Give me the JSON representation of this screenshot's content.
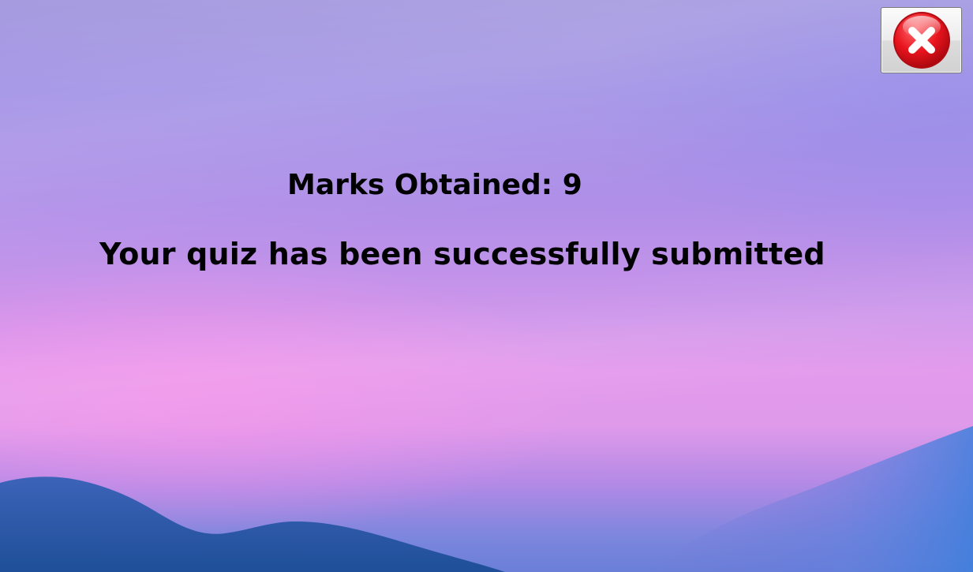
{
  "result": {
    "marks_label": "Marks Obtained:",
    "marks_value": "9",
    "marks_text": "Marks Obtained: 9",
    "message": "Your quiz has been successfully submitted"
  },
  "window": {
    "close_icon": "close-icon",
    "close_color": "#e8141d"
  },
  "theme": {
    "sky_top": "#a69bdf",
    "sky_pink": "#e39aec",
    "hill_color": "#2a5ea8"
  }
}
